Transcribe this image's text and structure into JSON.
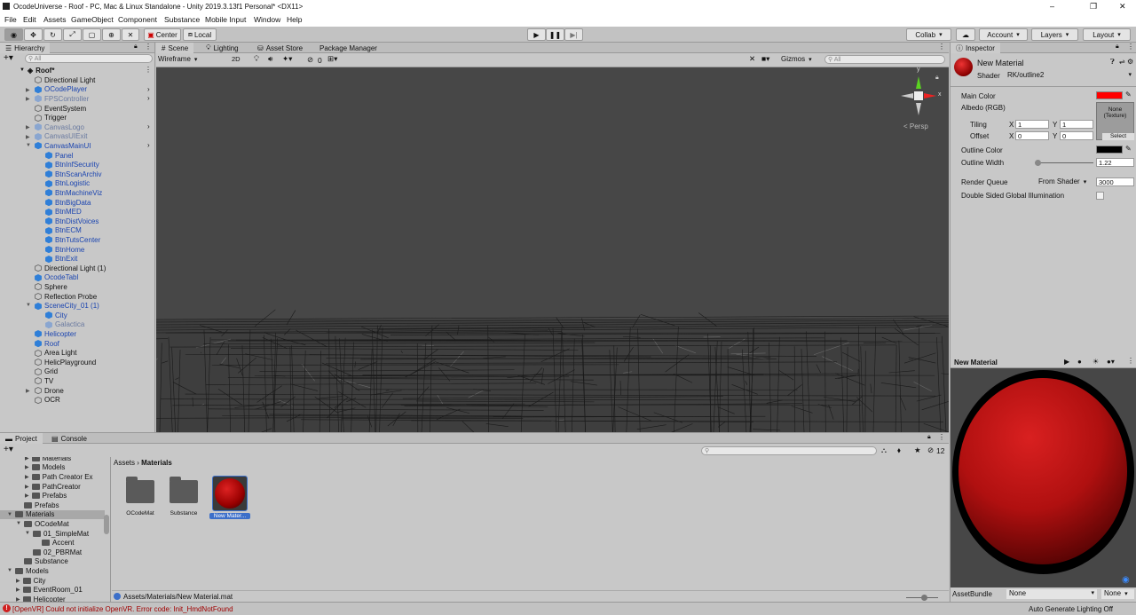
{
  "title": "OcodeUniverse - Roof - PC, Mac & Linux Standalone - Unity 2019.3.13f1 Personal* <DX11>",
  "window_controls": {
    "minimize": "–",
    "restore": "❐",
    "close": "✕"
  },
  "menu": [
    "File",
    "Edit",
    "Assets",
    "GameObject",
    "Component",
    "Substance",
    "Mobile Input",
    "Window",
    "Help"
  ],
  "toolbar": {
    "center": "Center",
    "local": "Local",
    "collab": "Collab",
    "account": "Account",
    "layers": "Layers",
    "layout": "Layout"
  },
  "hierarchy": {
    "tab": "Hierarchy",
    "search_placeholder": "All",
    "scene": "Roof*",
    "items": [
      {
        "label": "Directional Light",
        "depth": 1,
        "style": "normal",
        "expand": ""
      },
      {
        "label": "OCodePlayer",
        "depth": 1,
        "style": "blue",
        "expand": "▶",
        "more": true
      },
      {
        "label": "FPSController",
        "depth": 1,
        "style": "gray",
        "expand": "▶",
        "more": true
      },
      {
        "label": "EventSystem",
        "depth": 1,
        "style": "normal",
        "expand": ""
      },
      {
        "label": "Trigger",
        "depth": 1,
        "style": "normal",
        "expand": ""
      },
      {
        "label": "CanvasLogo",
        "depth": 1,
        "style": "gray",
        "expand": "▶",
        "more": true
      },
      {
        "label": "CanvasUIExit",
        "depth": 1,
        "style": "gray",
        "expand": "▶"
      },
      {
        "label": "CanvasMainUI",
        "depth": 1,
        "style": "blue",
        "expand": "▼",
        "more": true
      },
      {
        "label": "Panel",
        "depth": 2,
        "style": "blue",
        "expand": ""
      },
      {
        "label": "BtnInfSecurity",
        "depth": 2,
        "style": "blue",
        "expand": ""
      },
      {
        "label": "BtnScanArchiv",
        "depth": 2,
        "style": "blue",
        "expand": ""
      },
      {
        "label": "BtnLogistic",
        "depth": 2,
        "style": "blue",
        "expand": ""
      },
      {
        "label": "BtnMachineViz",
        "depth": 2,
        "style": "blue",
        "expand": ""
      },
      {
        "label": "BtnBigData",
        "depth": 2,
        "style": "blue",
        "expand": ""
      },
      {
        "label": "BtnMED",
        "depth": 2,
        "style": "blue",
        "expand": ""
      },
      {
        "label": "BtnDistVoices",
        "depth": 2,
        "style": "blue",
        "expand": ""
      },
      {
        "label": "BtnECM",
        "depth": 2,
        "style": "blue",
        "expand": ""
      },
      {
        "label": "BtnTutsCenter",
        "depth": 2,
        "style": "blue",
        "expand": ""
      },
      {
        "label": "BtnHome",
        "depth": 2,
        "style": "blue",
        "expand": ""
      },
      {
        "label": "BtnExit",
        "depth": 2,
        "style": "blue",
        "expand": ""
      },
      {
        "label": "Directional Light (1)",
        "depth": 1,
        "style": "normal",
        "expand": ""
      },
      {
        "label": "OcodeTabl",
        "depth": 1,
        "style": "blue",
        "expand": ""
      },
      {
        "label": "Sphere",
        "depth": 1,
        "style": "normal",
        "expand": ""
      },
      {
        "label": "Reflection Probe",
        "depth": 1,
        "style": "normal",
        "expand": ""
      },
      {
        "label": "SceneCity_01 (1)",
        "depth": 1,
        "style": "blue",
        "expand": "▼"
      },
      {
        "label": "City",
        "depth": 2,
        "style": "blue",
        "expand": ""
      },
      {
        "label": "Galactica",
        "depth": 2,
        "style": "gray",
        "expand": ""
      },
      {
        "label": "Helicopter",
        "depth": 1,
        "style": "blue",
        "expand": ""
      },
      {
        "label": "Roof",
        "depth": 1,
        "style": "blue",
        "expand": ""
      },
      {
        "label": "Area Light",
        "depth": 1,
        "style": "normal",
        "expand": ""
      },
      {
        "label": "HelicPlayground",
        "depth": 1,
        "style": "normal",
        "expand": ""
      },
      {
        "label": "Grid",
        "depth": 1,
        "style": "normal",
        "expand": ""
      },
      {
        "label": "TV",
        "depth": 1,
        "style": "normal",
        "expand": ""
      },
      {
        "label": "Drone",
        "depth": 1,
        "style": "normal",
        "expand": "▶"
      },
      {
        "label": "OCR",
        "depth": 1,
        "style": "normal",
        "expand": ""
      }
    ]
  },
  "scene_view": {
    "tabs": [
      "Scene",
      "Lighting",
      "Asset Store",
      "Package Manager"
    ],
    "draw_mode": "Wireframe",
    "mode_2d": "2D",
    "hidden_count": "0",
    "gizmos": "Gizmos",
    "search_placeholder": "All",
    "persp": "< Persp",
    "axis_y": "y",
    "axis_x": "x"
  },
  "inspector": {
    "tab": "Inspector",
    "material_name": "New Material",
    "shader_label": "Shader",
    "shader_value": "RK/outline2",
    "main_color_label": "Main Color",
    "albedo_label": "Albedo (RGB)",
    "texture_none": "None",
    "texture_type": "(Texture)",
    "select": "Select",
    "tiling_label": "Tiling",
    "offset_label": "Offset",
    "tiling_x": "1",
    "tiling_y": "1",
    "offset_x": "0",
    "offset_y": "0",
    "x_label": "X",
    "y_label": "Y",
    "outline_color_label": "Outline Color",
    "outline_width_label": "Outline Width",
    "outline_width_value": "1.22",
    "outline_width_fraction": 0.04,
    "render_queue_label": "Render Queue",
    "render_queue_mode": "From Shader",
    "render_queue_value": "3000",
    "double_sided_label": "Double Sided Global Illumination",
    "preview_title": "New Material",
    "assetbundle_label": "AssetBundle",
    "assetbundle_value": "None",
    "assetbundle_variant": "None",
    "colors": {
      "main": "#ff0000",
      "outline": "#000000"
    }
  },
  "project": {
    "tabs": [
      "Project",
      "Console"
    ],
    "tree": [
      {
        "label": "Materials",
        "depth": 2,
        "expand": "▶"
      },
      {
        "label": "Models",
        "depth": 2,
        "expand": "▶"
      },
      {
        "label": "Path Creator Ex",
        "depth": 2,
        "expand": "▶"
      },
      {
        "label": "PathCreator",
        "depth": 2,
        "expand": "▶"
      },
      {
        "label": "Prefabs",
        "depth": 2,
        "expand": "▶"
      },
      {
        "label": "Prefabs",
        "depth": 1,
        "expand": ""
      },
      {
        "label": "Materials",
        "depth": 0,
        "expand": "▼",
        "selected": true
      },
      {
        "label": "OCodeMat",
        "depth": 1,
        "expand": "▼"
      },
      {
        "label": "01_SimpleMat",
        "depth": 2,
        "expand": "▼"
      },
      {
        "label": "Accent",
        "depth": 3,
        "expand": ""
      },
      {
        "label": "02_PBRMat",
        "depth": 2,
        "expand": ""
      },
      {
        "label": "Substance",
        "depth": 1,
        "expand": ""
      },
      {
        "label": "Models",
        "depth": 0,
        "expand": "▼"
      },
      {
        "label": "City",
        "depth": 1,
        "expand": "▶"
      },
      {
        "label": "EventRoom_01",
        "depth": 1,
        "expand": "▶"
      },
      {
        "label": "Helicopter",
        "depth": 1,
        "expand": "▶"
      }
    ],
    "breadcrumb": [
      "Assets",
      "Materials"
    ],
    "assets": [
      {
        "label": "OCodeMat",
        "type": "folder"
      },
      {
        "label": "Substance",
        "type": "folder"
      },
      {
        "label": "New Mater...",
        "type": "material"
      }
    ],
    "path": "Assets/Materials/New Material.mat",
    "count": "12"
  },
  "status": {
    "error": "[OpenVR] Could not initialize OpenVR. Error code: Init_HmdNotFound",
    "right": "Auto Generate Lighting Off"
  }
}
